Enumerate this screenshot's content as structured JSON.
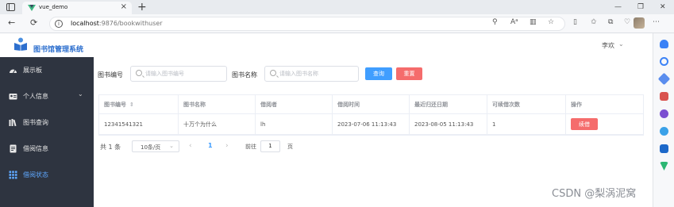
{
  "browser": {
    "tab_title": "vue_demo",
    "tab_close": "×",
    "new_tab": "+",
    "back": "←",
    "refresh": "⟳",
    "info": "i",
    "url_host": "localhost",
    "url_path": ":9876/bookwithuser",
    "minimize": "—",
    "maximize": "❐",
    "close": "✕"
  },
  "app": {
    "brand": "图书馆管理系统",
    "user": "李欢",
    "user_chevron": "⌄"
  },
  "sidebar": {
    "items": [
      {
        "label": "展示板",
        "icon": "dashboard-icon"
      },
      {
        "label": "个人信息",
        "icon": "id-card-icon",
        "arrow": "⌄"
      },
      {
        "label": "图书查询",
        "icon": "books-icon"
      },
      {
        "label": "借阅信息",
        "icon": "document-icon"
      },
      {
        "label": "借阅状态",
        "icon": "grid-icon"
      }
    ]
  },
  "search": {
    "book_no_label": "图书编号",
    "book_no_placeholder": "请输入图书编号",
    "book_name_label": "图书名称",
    "book_name_placeholder": "请输入图书名称",
    "query_button": "查询",
    "reset_button": "重置"
  },
  "table": {
    "headers": [
      "图书编号",
      "图书名称",
      "借阅者",
      "借阅时间",
      "最近归还日期",
      "可续借次数",
      "操作"
    ],
    "sort_icon": "⇕",
    "rows": [
      {
        "book_no": "12341541321",
        "book_name": "十万个为什么",
        "borrower": "lh",
        "borrow_time": "2023-07-06 11:13:43",
        "return_date": "2023-08-05 11:13:43",
        "renew_count": "1",
        "action": "续借"
      }
    ]
  },
  "pagination": {
    "total": "共 1 条",
    "page_size": "10条/页",
    "page_size_chevron": "⌄",
    "prev": "‹",
    "current": "1",
    "next": "›",
    "goto_label": "前往",
    "goto_value": "1",
    "goto_unit": "页"
  },
  "watermark": "CSDN @梨涡泥窝",
  "colors": {
    "primary": "#409eff",
    "danger": "#f56c6c",
    "sidebar_bg": "#2e3440",
    "brand": "#2d6fce"
  }
}
